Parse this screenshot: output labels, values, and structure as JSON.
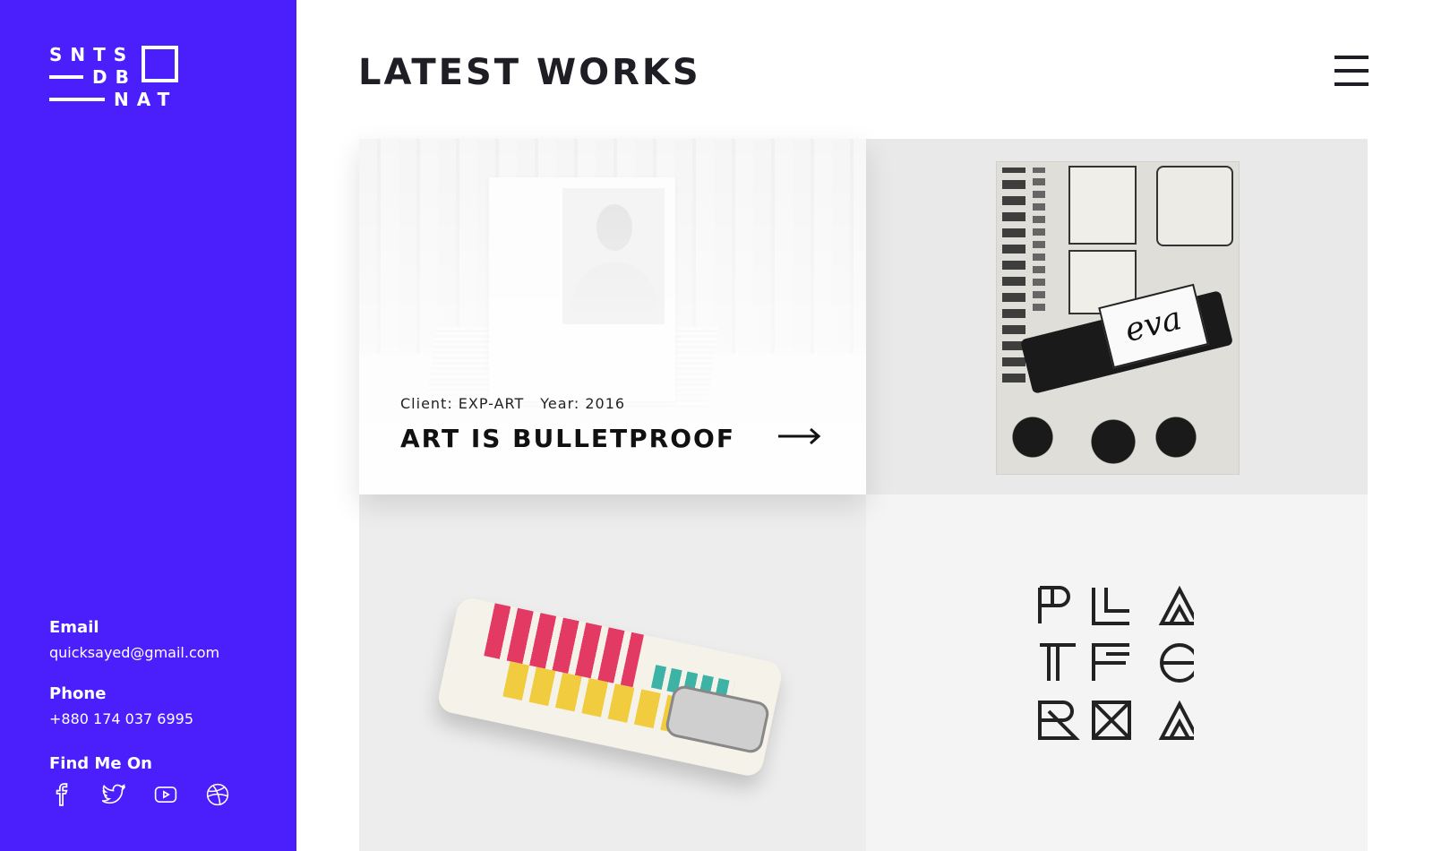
{
  "sidebar": {
    "bg_color": "#4a1ffc",
    "logo": {
      "line1": "SNTS",
      "line2": "DB",
      "line3": "NAT"
    },
    "contact": {
      "email_label": "Email",
      "email_value": "quicksayed@gmail.com",
      "phone_label": "Phone",
      "phone_value": "+880 174 037 6995",
      "find_label": "Find Me On"
    },
    "socials": [
      "facebook-icon",
      "twitter-icon",
      "youtube-icon",
      "dribbble-icon"
    ]
  },
  "main": {
    "title": "LATEST WORKS",
    "menu_icon": "hamburger-menu-icon",
    "works": [
      {
        "client": "Client: EXP-ART",
        "year": "Year: 2016",
        "title": "ART IS BULLETPROOF",
        "arrow_icon": "arrow-right-icon"
      },
      {
        "poster_text": "eva"
      },
      {},
      {}
    ]
  }
}
